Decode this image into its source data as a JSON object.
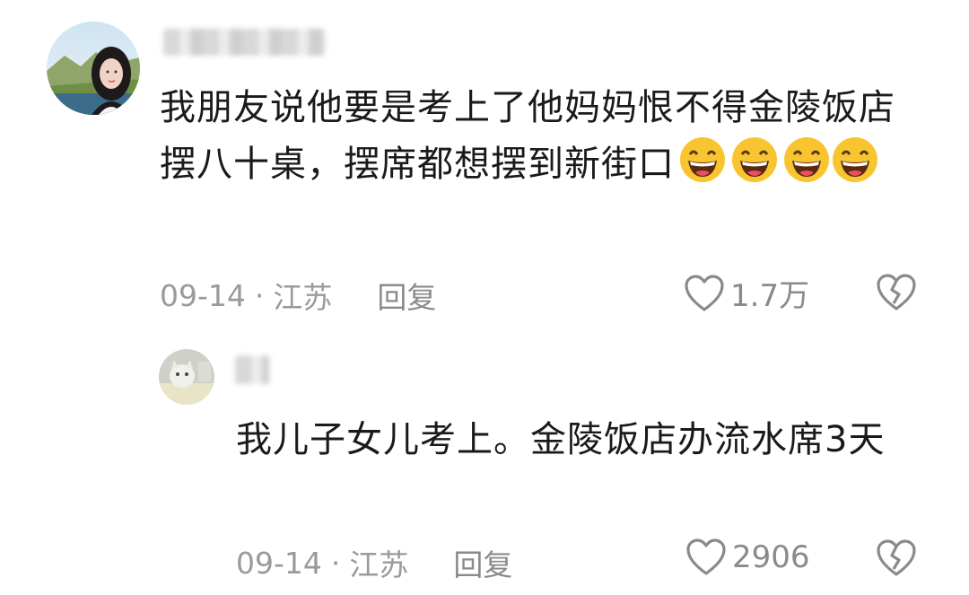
{
  "comment": {
    "text": "我朋友说他要是考上了他妈妈恨不得金陵饭店摆八十桌，摆席都想摆到新街口",
    "emoji_icon": "grinning-face-icon",
    "emoji_count": 4,
    "date": "09-14",
    "separator": "·",
    "location": "江苏",
    "reply_label": "回复",
    "likes": "1.7万"
  },
  "reply": {
    "text": "我儿子女儿考上。金陵饭店办流水席3天",
    "date": "09-14",
    "separator": "·",
    "location": "江苏",
    "reply_label": "回复",
    "likes": "2906"
  },
  "colors": {
    "text": "#1a1a1a",
    "meta": "#9a9a9a",
    "icon": "#8a8a8a",
    "emoji_face": "#f8c531"
  }
}
